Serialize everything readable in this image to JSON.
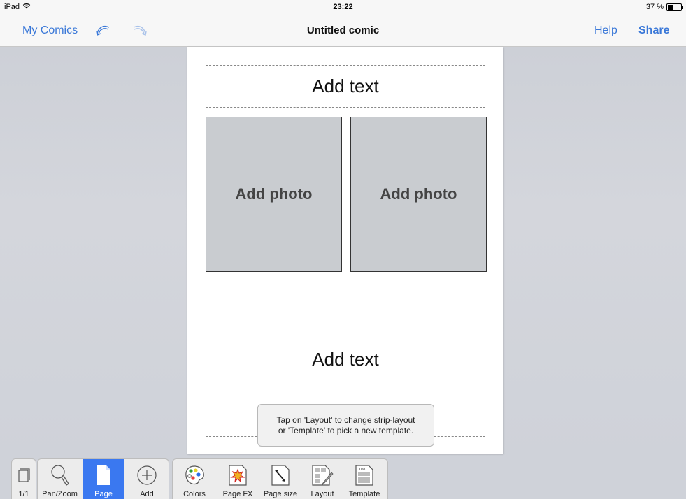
{
  "status_bar": {
    "device": "iPad",
    "time": "23:22",
    "battery": "37 %"
  },
  "nav": {
    "back_label": "My Comics",
    "title": "Untitled comic",
    "help_label": "Help",
    "share_label": "Share"
  },
  "page": {
    "top_text": "Add text",
    "photo_left": "Add photo",
    "photo_right": "Add photo",
    "bottom_text": "Add text"
  },
  "tooltip": {
    "line1": "Tap on 'Layout' to change strip-layout",
    "line2": "or 'Template' to pick a new template."
  },
  "toolbar": {
    "page_counter": "1/1",
    "pan_zoom": "Pan/Zoom",
    "page": "Page",
    "add": "Add",
    "colors": "Colors",
    "page_fx": "Page FX",
    "page_size": "Page size",
    "layout": "Layout",
    "template": "Template",
    "template_icon_text": "Title"
  },
  "colors": {
    "accent": "#3a78d8",
    "active_tool": "#3a78f0"
  }
}
